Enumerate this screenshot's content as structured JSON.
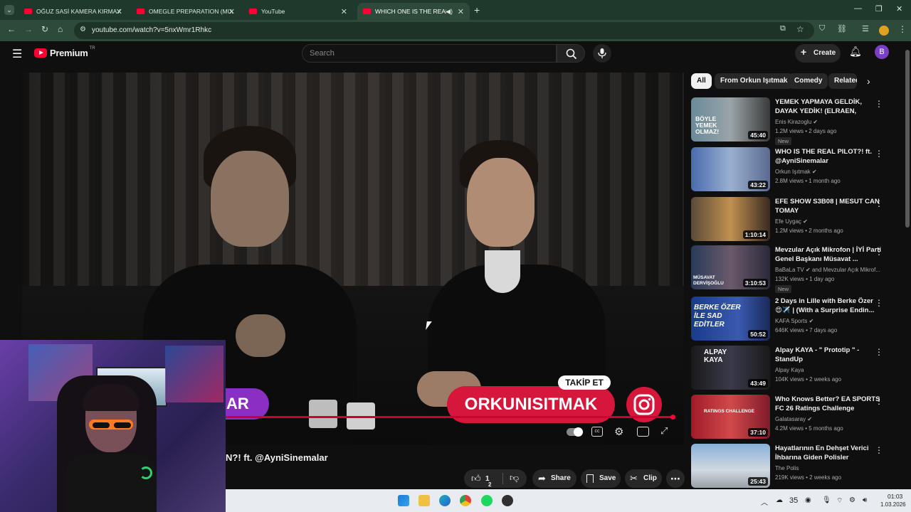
{
  "browser": {
    "tabs": [
      {
        "title": "OĞUZ SASİ KAMERA KIRMA AN"
      },
      {
        "title": "OMEGLE PREPARATION (MUA)"
      },
      {
        "title": "YouTube"
      },
      {
        "title": "WHICH ONE IS THE REAL S"
      }
    ],
    "new_tab": "+",
    "url": "youtube.com/watch?v=5nxWmr1Rhkc"
  },
  "youtube": {
    "logo": "Premium",
    "region": "TR",
    "search_placeholder": "Search",
    "create_label": "Create",
    "avatar_letter": "B"
  },
  "video": {
    "overlay_badge_left": "AR",
    "follow_badge": "TAKİP ET",
    "banner_text": "ORKUNISITMAK",
    "title_visible": "N?! ft. @AyniSinemalar",
    "like_count": "1",
    "like_count_sub": "2",
    "progress_fraction": 0.99
  },
  "actions": {
    "share": "Share",
    "save": "Save",
    "clip": "Clip"
  },
  "chips": [
    "All",
    "From Orkun Işıtmak",
    "Comedy",
    "Related"
  ],
  "recommendations": [
    {
      "title": "YEMEK YAPMAYA GELDİK, DAYAK YEDİK! (ELRAEN, ERAY,...",
      "channel": "Enis Kirazoglu",
      "verified": true,
      "meta": "1.2M views • 2 days ago",
      "duration": "45:40",
      "new": "New",
      "thumb_text": "BÖYLE YEMEK OLMAZ!"
    },
    {
      "title": "WHO IS THE REAL PILOT?! ft. @AyniSinemalar",
      "channel": "Orkun Işıtmak",
      "verified": true,
      "meta": "2.8M views • 1 month ago",
      "duration": "43:22",
      "new": "",
      "thumb_text": ""
    },
    {
      "title": "EFE SHOW S3B08 | MESUT CAN TOMAY",
      "channel": "Efe Uygaç",
      "verified": true,
      "meta": "1.2M views • 2 months ago",
      "duration": "1:10:14",
      "new": "",
      "thumb_text": ""
    },
    {
      "title": "Mevzular Açık Mikrofon | İYİ Parti Genel Başkanı Müsavat ...",
      "channel": "BaBaLa TV",
      "verified": true,
      "channel_extra": "and Mevzular Açık Mikrof...",
      "meta": "132K views • 1 day ago",
      "duration": "3:10:53",
      "new": "New",
      "thumb_text": "MÜSAVAT DERVİŞOĞLU"
    },
    {
      "title": "2 Days in Lille with Berke Özer 😍✈️ | (With a Surprise Endin...",
      "channel": "KAFA Sports",
      "verified": true,
      "meta": "646K views • 7 days ago",
      "duration": "50:52",
      "new": "",
      "thumb_text": "BERKE ÖZER İLE SAD EDİTLER"
    },
    {
      "title": "Alpay KAYA - \" Prototip \" - StandUp",
      "channel": "Alpay Kaya",
      "verified": false,
      "meta": "104K views • 2 weeks ago",
      "duration": "43:49",
      "new": "",
      "thumb_text": "ALPAY KAYA"
    },
    {
      "title": "Who Knows Better? EA SPORTS FC 26 Ratings Challenge",
      "channel": "Galatasaray",
      "verified": true,
      "meta": "4.2M views • 5 months ago",
      "duration": "37:10",
      "new": "",
      "thumb_text": "RATINGS CHALLENGE"
    },
    {
      "title": "Hayatlarının En Dehşet Verici İhbarına Giden Polisler",
      "channel": "The Polis",
      "verified": false,
      "meta": "219K views • 2 weeks ago",
      "duration": "25:43",
      "new": "",
      "thumb_text": ""
    }
  ],
  "taskbar": {
    "weather": "35",
    "time": "01:03",
    "date": "1.03.2026"
  },
  "colors": {
    "browser_chrome": "#2d4a3a",
    "yt_bg": "#0f0f0f",
    "accent_red": "#ff0033",
    "banner_red": "#d6163b"
  }
}
